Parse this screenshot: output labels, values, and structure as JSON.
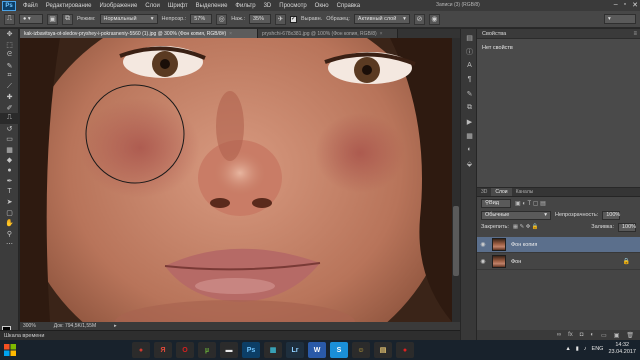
{
  "app": {
    "logo": "Ps",
    "menu": [
      "Файл",
      "Редактирование",
      "Изображение",
      "Слои",
      "Шрифт",
      "Выделение",
      "Фильтр",
      "3D",
      "Просмотр",
      "Окно",
      "Справка"
    ],
    "doc_label": "Записи (3) (RGB/8)"
  },
  "options": {
    "mode_label": "Режим:",
    "mode_value": "Нормальный",
    "opacity_label": "Непрозр.:",
    "opacity_value": "57%",
    "flow_label": "Наж.:",
    "flow_value": "35%",
    "aligned_label": "Выравн.",
    "sample_label": "Образец:",
    "sample_value": "Активный слой"
  },
  "tabs": [
    {
      "label": "kak-izbavitsya-ot-sledov-pryshey-i-pokrasneniy-5560 (1).jpg @ 300% (Фон копия, RGB/8#)",
      "active": true
    },
    {
      "label": "pryshchi-678x381.jpg @ 100% (Фон копия, RGB/8)",
      "active": false
    }
  ],
  "status": {
    "zoom": "300%",
    "doc": "Док: 794,5K/1,55M"
  },
  "timeline": {
    "label": "Шкала времени"
  },
  "properties": {
    "title": "Свойства",
    "empty_text": "Нет свойств"
  },
  "layers_panel": {
    "tabs": [
      "3D",
      "Слои",
      "Каналы"
    ],
    "active_tab": 1,
    "kind_label": "Вид",
    "blend_value": "Обычные",
    "opacity_label": "Непрозрачность:",
    "opacity_value": "100%",
    "lock_label": "Закрепить:",
    "fill_label": "Заливка:",
    "fill_value": "100%",
    "layers": [
      {
        "name": "Фон копия",
        "selected": true
      },
      {
        "name": "Фон",
        "selected": false
      }
    ]
  },
  "taskbar": {
    "apps": [
      {
        "icon": "chrome-icon",
        "glyph": "●",
        "bg": "#2b2b2b",
        "color": "#d03a2e"
      },
      {
        "icon": "yandex-icon",
        "glyph": "Я",
        "bg": "#2b2b2b",
        "color": "#e04a3a"
      },
      {
        "icon": "opera-icon",
        "glyph": "O",
        "bg": "#2b2b2b",
        "color": "#d42020"
      },
      {
        "icon": "utorrent-icon",
        "glyph": "µ",
        "bg": "#2b2b2b",
        "color": "#6ab03a"
      },
      {
        "icon": "terminal-icon",
        "glyph": "▬",
        "bg": "#2b2b2b",
        "color": "#e8e8e8"
      },
      {
        "icon": "photoshop-icon",
        "glyph": "Ps",
        "bg": "#0c3e66",
        "color": "#6fc4ff"
      },
      {
        "icon": "ai-icon",
        "glyph": "▦",
        "bg": "#2b2b2b",
        "color": "#3ab0c8"
      },
      {
        "icon": "lightroom-icon",
        "glyph": "Lr",
        "bg": "#1e2f3e",
        "color": "#8fd0ff"
      },
      {
        "icon": "word-icon",
        "glyph": "W",
        "bg": "#2a5aa8",
        "color": "#ffffff"
      },
      {
        "icon": "skype-icon",
        "glyph": "S",
        "bg": "#1a8fd8",
        "color": "#ffffff"
      },
      {
        "icon": "messenger-icon",
        "glyph": "☺",
        "bg": "#2b2b2b",
        "color": "#e8c040"
      },
      {
        "icon": "folder-icon",
        "glyph": "▤",
        "bg": "#2b2b2b",
        "color": "#e0c070"
      },
      {
        "icon": "record-icon",
        "glyph": "●",
        "bg": "#2b2b2b",
        "color": "#e02020"
      }
    ],
    "lang": "ENG",
    "time": "14:32",
    "date": "23.04.2017"
  }
}
